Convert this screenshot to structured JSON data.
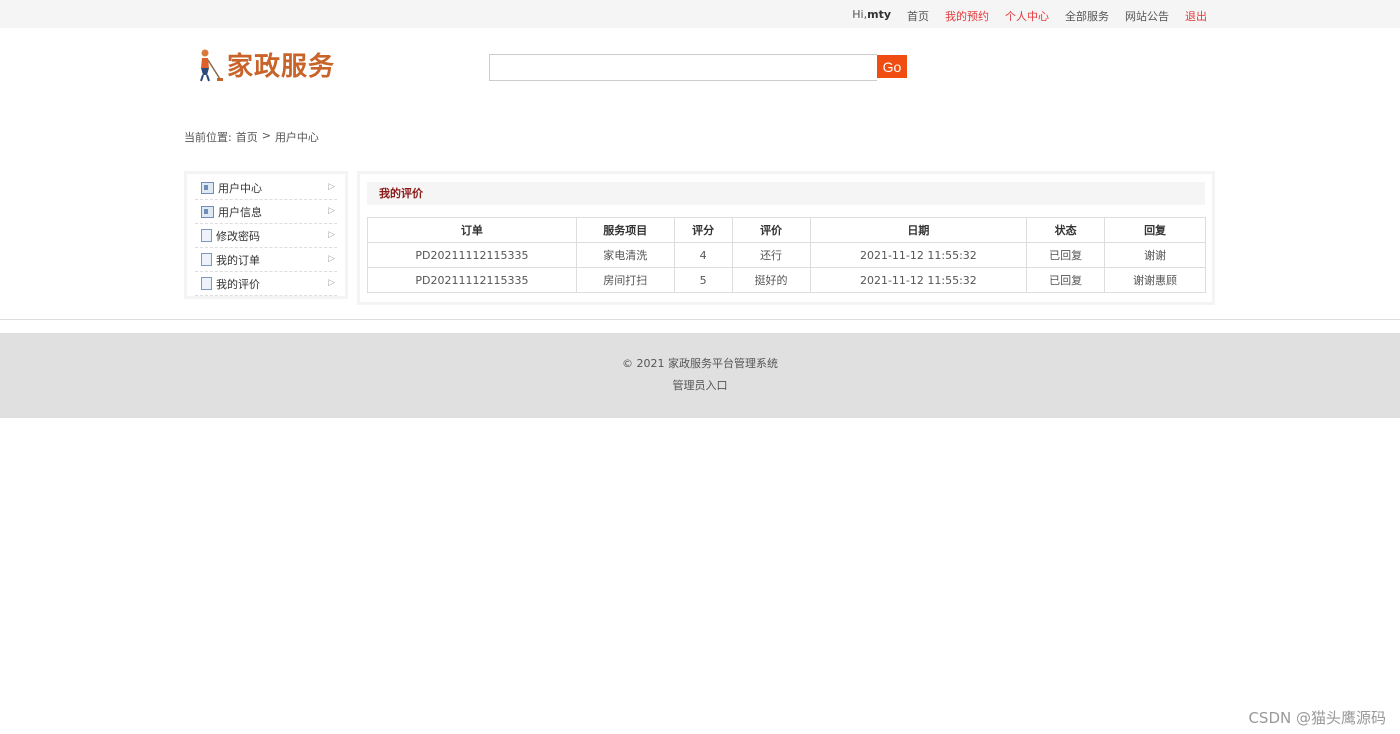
{
  "topbar": {
    "greeting_prefix": "Hi,",
    "username": "mty",
    "links": [
      "首页",
      "我的预约",
      "个人中心",
      "全部服务",
      "网站公告",
      "退出"
    ]
  },
  "header": {
    "logo_text": "家政服务",
    "search_value": "",
    "go_label": "Go"
  },
  "breadcrumb": {
    "prefix": "当前位置:",
    "home": "首页",
    "separator": ">",
    "current": "用户中心"
  },
  "sidebar": {
    "items": [
      {
        "label": "用户中心",
        "icon": "id-card-icon"
      },
      {
        "label": "用户信息",
        "icon": "id-card-icon"
      },
      {
        "label": "修改密码",
        "icon": "document-icon"
      },
      {
        "label": "我的订单",
        "icon": "document-icon"
      },
      {
        "label": "我的评价",
        "icon": "document-icon"
      }
    ]
  },
  "panel": {
    "title": "我的评价",
    "columns": [
      "订单",
      "服务项目",
      "评分",
      "评价",
      "日期",
      "状态",
      "回复"
    ],
    "rows": [
      [
        "PD20211112115335",
        "家电清洗",
        "4",
        "还行",
        "2021-11-12 11:55:32",
        "已回复",
        "谢谢"
      ],
      [
        "PD20211112115335",
        "房间打扫",
        "5",
        "挺好的",
        "2021-11-12 11:55:32",
        "已回复",
        "谢谢惠顾"
      ]
    ]
  },
  "footer": {
    "copyright": "© 2021 家政服务平台管理系统",
    "admin_link": "管理员入口"
  },
  "watermark": "CSDN @猫头鹰源码",
  "colors": {
    "accent": "#f04d12",
    "logo": "#c8642a",
    "link_red": "#e4393c",
    "panel_title": "#8b1a1a"
  }
}
